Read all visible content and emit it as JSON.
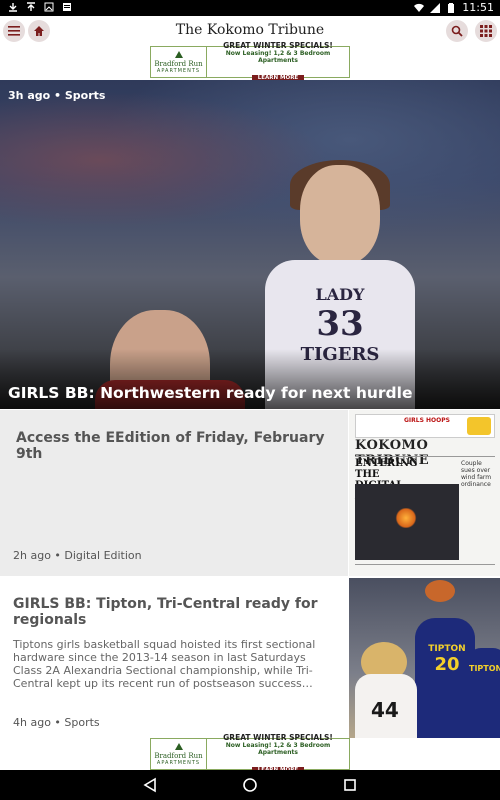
{
  "status_bar": {
    "time": "11:51",
    "icons_left": [
      "download-icon",
      "upload-icon",
      "image-icon",
      "news-icon"
    ],
    "icons_right": [
      "wifi-icon",
      "signal-icon",
      "battery-icon"
    ]
  },
  "app_bar": {
    "title": "The Kokomo Tribune"
  },
  "ad": {
    "logo_name": "Bradford Run",
    "logo_sub": "APARTMENTS",
    "headline": "GREAT WINTER SPECIALS!",
    "subline": "Now Leasing! 1,2 & 3 Bedroom Apartments",
    "cta": "LEARN MORE"
  },
  "hero": {
    "meta": "3h ago • Sports",
    "title": "GIRLS BB: Northwestern ready for next hurdle",
    "jersey_top": "LADY",
    "jersey_number": "33",
    "jersey_team": "TIGERS"
  },
  "cards": [
    {
      "title": "Access the EEdition of Friday, February 9th",
      "meta": "2h ago • Digital Edition",
      "thumb": {
        "masthead": "KOKOMO TRIBUNE",
        "promo": "GIRLS HOOPS",
        "headline": "ENTERING THE DIGITAL AGE",
        "column": "Couple sues over wind farm ordinance"
      }
    },
    {
      "title": "GIRLS BB: Tipton, Tri-Central ready for regionals",
      "summary": "Tiptons girls basketball squad hoisted its first sectional hardware since the 2013-14 season in last Saturdays Class 2A Alexandria Sectional championship, while Tri-Central kept up its recent run of postseason success…",
      "meta": "4h ago • Sports",
      "thumb": {
        "team": "TIPTON",
        "number": "20",
        "other_number": "44",
        "team2": "TIPTON"
      }
    }
  ],
  "colors": {
    "accent": "#7b1d1d",
    "button_bg": "#e6dcdc",
    "ad_green": "#2b5e22"
  }
}
